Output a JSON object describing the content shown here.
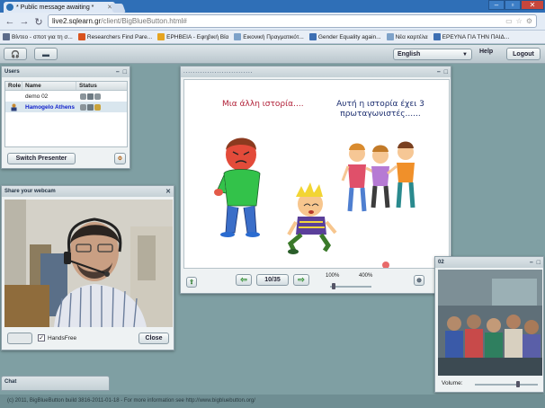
{
  "browser": {
    "tab_title": "* Public message awaiting *",
    "url_host": "live2.sqlearn.gr",
    "url_path": "/client/BigBlueButton.html#",
    "bookmarks": [
      {
        "label": "Βίντεο - σποτ για τη σ...",
        "color": "#5b6b8a"
      },
      {
        "label": "Researchers Find Pare...",
        "color": "#d9531e"
      },
      {
        "label": "ΕΡΗΒΕΙΑ - Εφηβική Βία",
        "color": "#e6a41f"
      },
      {
        "label": "Εικονική Πραγματικότ...",
        "color": "#7ea2c9"
      },
      {
        "label": "Gender Equality again...",
        "color": "#3d6fb3"
      },
      {
        "label": "Νέα καρτέλα",
        "color": "#7ea2c9"
      },
      {
        "label": "ΕΡΕΥΝΑ ΓΙΑ ΤΗΝ ΠΑΙΔ...",
        "color": "#3d6fb3"
      }
    ]
  },
  "app": {
    "language": "English",
    "help_label": "Help",
    "logout_label": "Logout"
  },
  "users_window": {
    "title": "Users",
    "columns": [
      "Role",
      "Name",
      "Status"
    ],
    "rows": [
      {
        "name": "demo 02",
        "is_presenter": false
      },
      {
        "name": "Hamogelo Athens",
        "is_presenter": true
      }
    ],
    "switch_presenter_label": "Switch Presenter"
  },
  "webcam_window": {
    "title": "Share your webcam",
    "handsfree_label": "HandsFree",
    "handsfree_checked": true,
    "close_label": "Close"
  },
  "presentation": {
    "slide_left_text": "Μια άλλη ιστορία....",
    "slide_right_text": "Αυτή η ιστορία έχει 3 πρωταγωνιστές......",
    "page_label": "10/35",
    "zoom_min_label": "100%",
    "zoom_max_label": "400%",
    "zoom_value": 0.05
  },
  "remote_cam": {
    "title": "02",
    "volume_label": "Volume:",
    "volume_value": 0.7
  },
  "chat": {
    "title": "Chat"
  },
  "footer": {
    "text": "(c) 2011, BigBlueButton build 3816-2011-01-18 - For more information see http://www.bigbluebutton.org/"
  }
}
